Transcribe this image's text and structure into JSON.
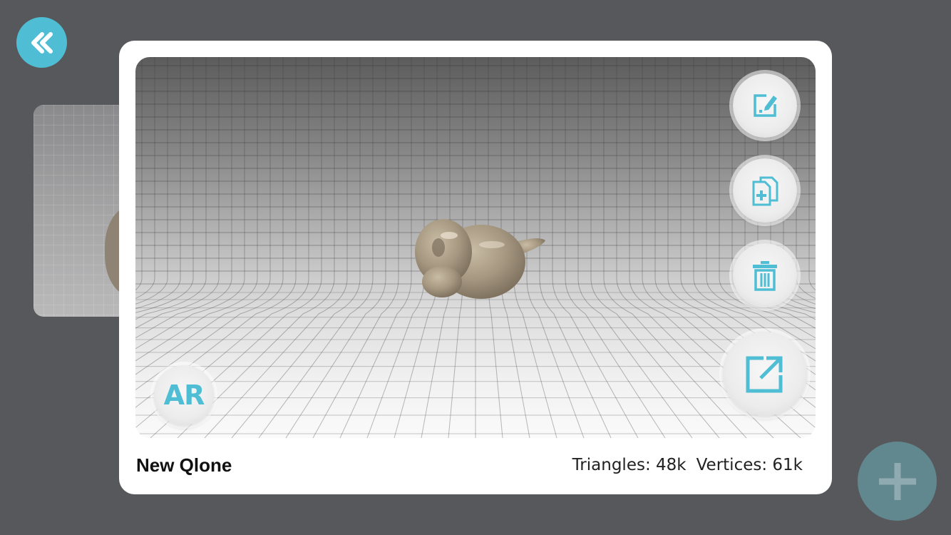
{
  "navigation": {
    "back_icon": "double-chevron-left-icon"
  },
  "background_card": {
    "thumbnail": "scan-thumbnail"
  },
  "viewer": {
    "ar_label": "AR",
    "actions": [
      {
        "name": "edit",
        "icon": "edit-icon"
      },
      {
        "name": "duplicate",
        "icon": "duplicate-icon"
      },
      {
        "name": "delete",
        "icon": "trash-icon"
      },
      {
        "name": "share",
        "icon": "share-icon"
      }
    ]
  },
  "model": {
    "name": "New Qlone",
    "triangles": "Triangles: 48k",
    "vertices": "Vertices: 61k"
  },
  "fab": {
    "icon": "plus-icon"
  },
  "colors": {
    "accent": "#4fbdd3",
    "background": "#56585c",
    "fab": "#62888f",
    "modal": "#ffffff"
  }
}
